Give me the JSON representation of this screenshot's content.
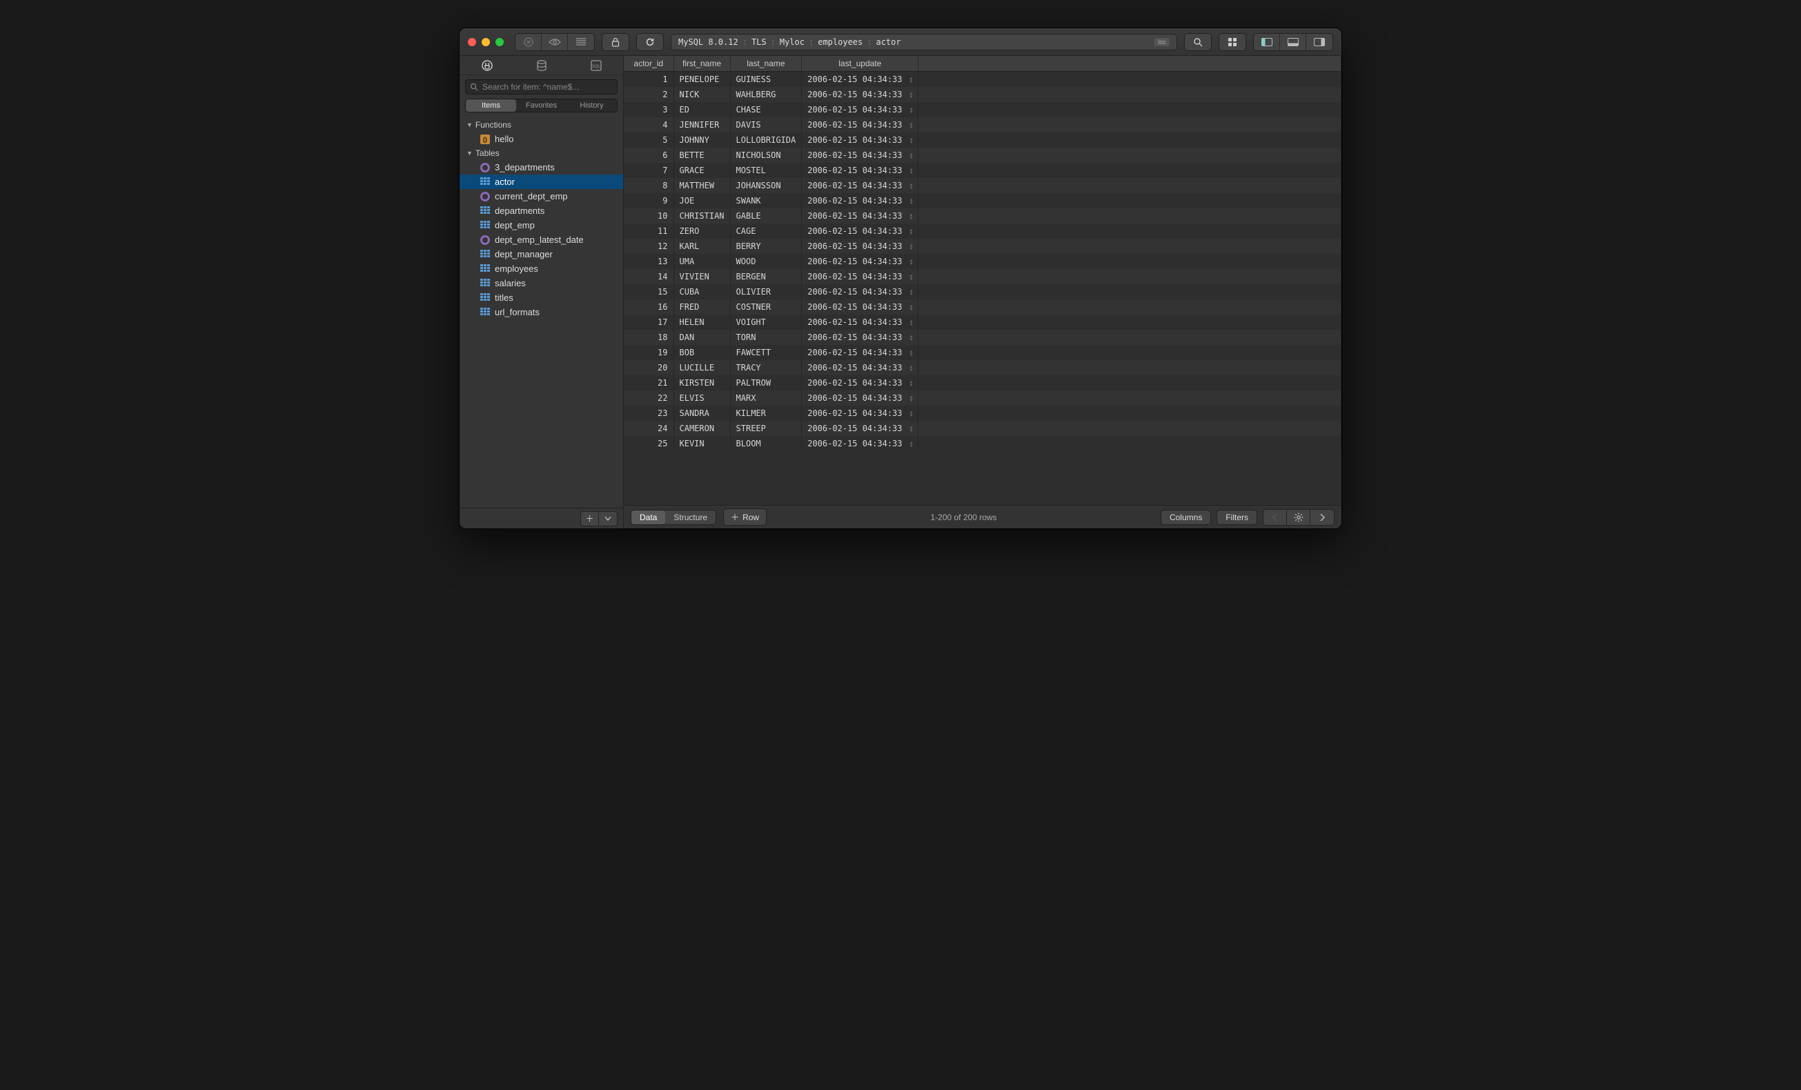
{
  "titlebar": {
    "breadcrumb": [
      "MySQL 8.0.12",
      "TLS",
      "Myloc",
      "employees",
      "actor"
    ],
    "loc_badge": "loc"
  },
  "sidebar": {
    "search_placeholder": "Search for item: ^name$...",
    "segments": [
      "Items",
      "Favorites",
      "History"
    ],
    "active_segment": 0,
    "functions_header": "Functions",
    "functions": [
      {
        "name": "hello",
        "kind": "fn"
      }
    ],
    "tables_header": "Tables",
    "tables": [
      {
        "name": "3_departments",
        "kind": "view"
      },
      {
        "name": "actor",
        "kind": "table",
        "selected": true
      },
      {
        "name": "current_dept_emp",
        "kind": "view"
      },
      {
        "name": "departments",
        "kind": "table"
      },
      {
        "name": "dept_emp",
        "kind": "table"
      },
      {
        "name": "dept_emp_latest_date",
        "kind": "view"
      },
      {
        "name": "dept_manager",
        "kind": "table"
      },
      {
        "name": "employees",
        "kind": "table"
      },
      {
        "name": "salaries",
        "kind": "table"
      },
      {
        "name": "titles",
        "kind": "table"
      },
      {
        "name": "url_formats",
        "kind": "table"
      }
    ]
  },
  "columns": [
    "actor_id",
    "first_name",
    "last_name",
    "last_update"
  ],
  "rows": [
    [
      1,
      "PENELOPE",
      "GUINESS",
      "2006-02-15 04:34:33"
    ],
    [
      2,
      "NICK",
      "WAHLBERG",
      "2006-02-15 04:34:33"
    ],
    [
      3,
      "ED",
      "CHASE",
      "2006-02-15 04:34:33"
    ],
    [
      4,
      "JENNIFER",
      "DAVIS",
      "2006-02-15 04:34:33"
    ],
    [
      5,
      "JOHNNY",
      "LOLLOBRIGIDA",
      "2006-02-15 04:34:33"
    ],
    [
      6,
      "BETTE",
      "NICHOLSON",
      "2006-02-15 04:34:33"
    ],
    [
      7,
      "GRACE",
      "MOSTEL",
      "2006-02-15 04:34:33"
    ],
    [
      8,
      "MATTHEW",
      "JOHANSSON",
      "2006-02-15 04:34:33"
    ],
    [
      9,
      "JOE",
      "SWANK",
      "2006-02-15 04:34:33"
    ],
    [
      10,
      "CHRISTIAN",
      "GABLE",
      "2006-02-15 04:34:33"
    ],
    [
      11,
      "ZERO",
      "CAGE",
      "2006-02-15 04:34:33"
    ],
    [
      12,
      "KARL",
      "BERRY",
      "2006-02-15 04:34:33"
    ],
    [
      13,
      "UMA",
      "WOOD",
      "2006-02-15 04:34:33"
    ],
    [
      14,
      "VIVIEN",
      "BERGEN",
      "2006-02-15 04:34:33"
    ],
    [
      15,
      "CUBA",
      "OLIVIER",
      "2006-02-15 04:34:33"
    ],
    [
      16,
      "FRED",
      "COSTNER",
      "2006-02-15 04:34:33"
    ],
    [
      17,
      "HELEN",
      "VOIGHT",
      "2006-02-15 04:34:33"
    ],
    [
      18,
      "DAN",
      "TORN",
      "2006-02-15 04:34:33"
    ],
    [
      19,
      "BOB",
      "FAWCETT",
      "2006-02-15 04:34:33"
    ],
    [
      20,
      "LUCILLE",
      "TRACY",
      "2006-02-15 04:34:33"
    ],
    [
      21,
      "KIRSTEN",
      "PALTROW",
      "2006-02-15 04:34:33"
    ],
    [
      22,
      "ELVIS",
      "MARX",
      "2006-02-15 04:34:33"
    ],
    [
      23,
      "SANDRA",
      "KILMER",
      "2006-02-15 04:34:33"
    ],
    [
      24,
      "CAMERON",
      "STREEP",
      "2006-02-15 04:34:33"
    ],
    [
      25,
      "KEVIN",
      "BLOOM",
      "2006-02-15 04:34:33"
    ]
  ],
  "footer": {
    "view_toggle": [
      "Data",
      "Structure"
    ],
    "active_view": 0,
    "row_btn": "Row",
    "status": "1-200 of 200 rows",
    "columns_btn": "Columns",
    "filters_btn": "Filters"
  }
}
